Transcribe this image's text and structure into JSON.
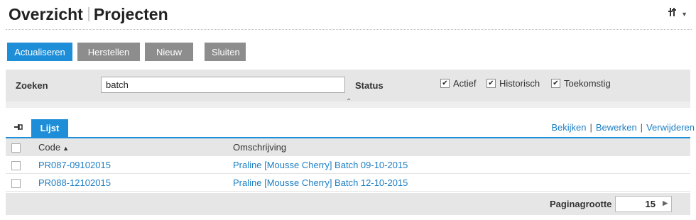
{
  "header": {
    "title_part1": "Overzicht",
    "title_part2": "Projecten",
    "tools_icon": "⁞⁞"
  },
  "toolbar": {
    "refresh": "Actualiseren",
    "restore": "Herstellen",
    "new": "Nieuw",
    "close": "Sluiten"
  },
  "search": {
    "label": "Zoeken",
    "value": "batch",
    "status_label": "Status",
    "filters": [
      {
        "label": "Actief",
        "checked": true
      },
      {
        "label": "Historisch",
        "checked": true
      },
      {
        "label": "Toekomstig",
        "checked": true
      }
    ]
  },
  "tabs": {
    "list": "Lijst"
  },
  "actions": {
    "view": "Bekijken",
    "edit": "Bewerken",
    "delete": "Verwijderen"
  },
  "table": {
    "columns": {
      "code": "Code",
      "description": "Omschrijving"
    },
    "rows": [
      {
        "code": "PR087-09102015",
        "description": "Praline [Mousse Cherry] Batch 09-10-2015"
      },
      {
        "code": "PR088-12102015",
        "description": "Praline [Mousse Cherry] Batch 12-10-2015"
      }
    ]
  },
  "pagination": {
    "label": "Paginagrootte",
    "value": "15"
  },
  "colors": {
    "accent": "#1d8ed7",
    "button_gray": "#8d8d8d",
    "link": "#1d7fc4",
    "panel": "#e6e6e6"
  }
}
